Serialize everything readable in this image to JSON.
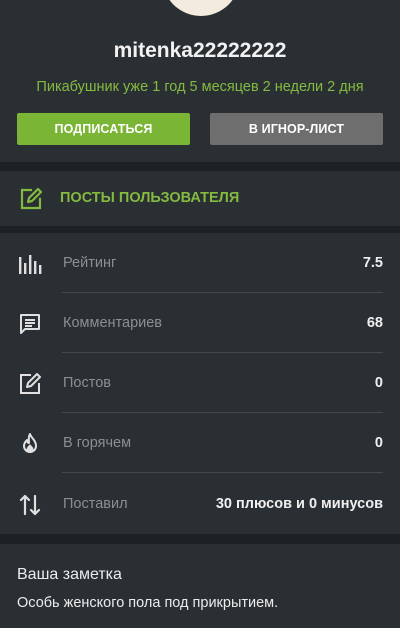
{
  "profile": {
    "username": "mitenka22222222",
    "tenure": "Пикабушник уже 1 год 5 месяцев 2 недели 2 дня"
  },
  "actions": {
    "subscribe_label": "ПОДПИСАТЬСЯ",
    "ignore_label": "В ИГНОР-ЛИСТ"
  },
  "posts_link": {
    "label": "ПОСТЫ ПОЛЬЗОВАТЕЛЯ",
    "icon": "edit-icon"
  },
  "stats": [
    {
      "icon": "rating-bars-icon",
      "label": "Рейтинг",
      "value": "7.5"
    },
    {
      "icon": "comment-icon",
      "label": "Комментариев",
      "value": "68"
    },
    {
      "icon": "edit-icon",
      "label": "Постов",
      "value": "0"
    },
    {
      "icon": "flame-icon",
      "label": "В горячем",
      "value": "0"
    },
    {
      "icon": "swap-arrows-icon",
      "label": "Поставил",
      "value": "30 плюсов и 0 минусов"
    }
  ],
  "note": {
    "title": "Ваша заметка",
    "text": "Особь женского пола под прикрытием."
  },
  "colors": {
    "background": "#2a2f33",
    "accent_green": "#84ba40",
    "button_green": "#7ab536",
    "button_gray": "#6e6e6e"
  }
}
